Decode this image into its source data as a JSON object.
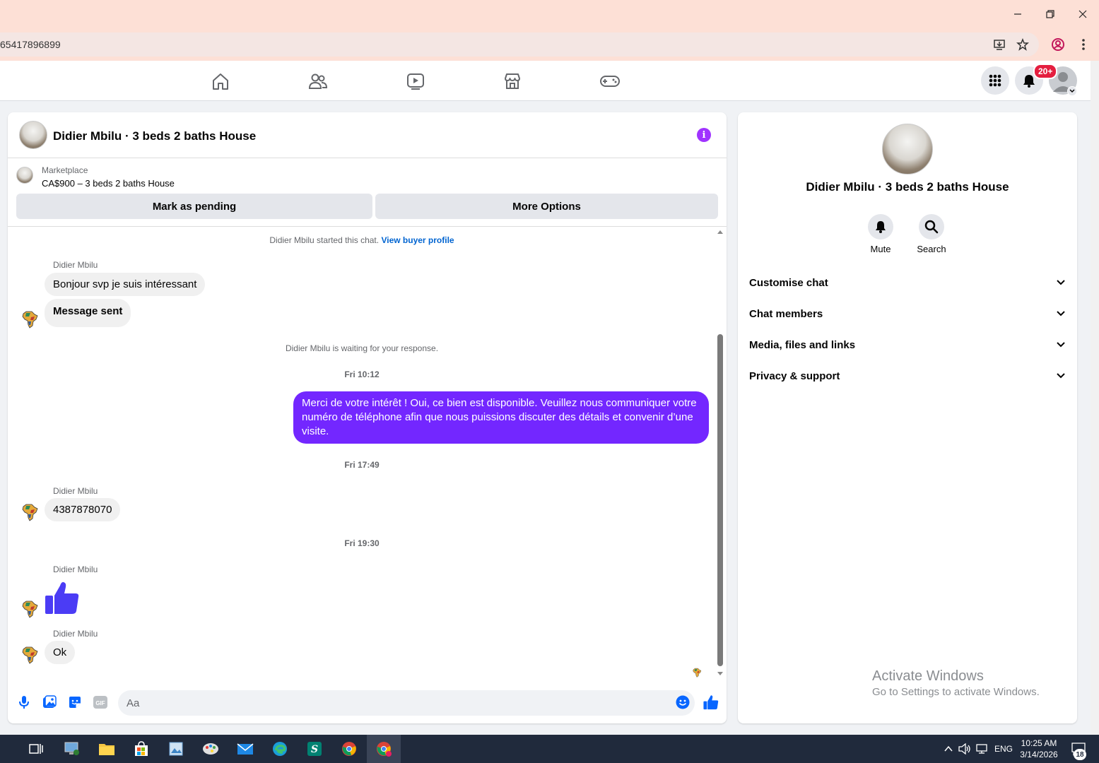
{
  "browser": {
    "url_fragment": "65417896899"
  },
  "nav": {
    "notification_badge": "20+"
  },
  "chat": {
    "title": "Didier Mbilu · 3 beds 2 baths House",
    "marketplace_label": "Marketplace",
    "listing": "CA$900 – 3 beds 2 baths House",
    "mark_pending_label": "Mark as pending",
    "more_options_label": "More Options",
    "started_text": "Didier Mbilu started this chat.",
    "view_buyer_profile": "View buyer profile",
    "messages": {
      "sender": "Didier Mbilu",
      "msg1": "Bonjour svp je suis intéressant",
      "msg2": "Message sent",
      "waiting": "Didier Mbilu is waiting for your response.",
      "time1": "Fri 10:12",
      "out1": "Merci de votre intérêt ! Oui, ce bien est disponible. Veuillez nous communiquer votre numéro de téléphone afin que nous puissions discuter des détails et convenir d’une visite.",
      "time2": "Fri 17:49",
      "msg3": "4387878070",
      "time3": "Fri 19:30",
      "msg5": "Ok"
    },
    "input_placeholder": "Aa"
  },
  "right_panel": {
    "name": "Didier Mbilu · 3 beds 2 baths House",
    "mute_label": "Mute",
    "search_label": "Search",
    "sections": {
      "customise": "Customise chat",
      "members": "Chat members",
      "media": "Media, files and links",
      "privacy": "Privacy & support"
    }
  },
  "watermark": {
    "line1": "Activate Windows",
    "line2": "Go to Settings to activate Windows."
  },
  "taskbar": {
    "language": "ENG",
    "time": "10:25 AM",
    "date": "3/14/2026",
    "notification_count": "18"
  },
  "colors": {
    "accent": "#7327ff",
    "like_blue": "#0866ff",
    "badge_red": "#e41e3f"
  }
}
